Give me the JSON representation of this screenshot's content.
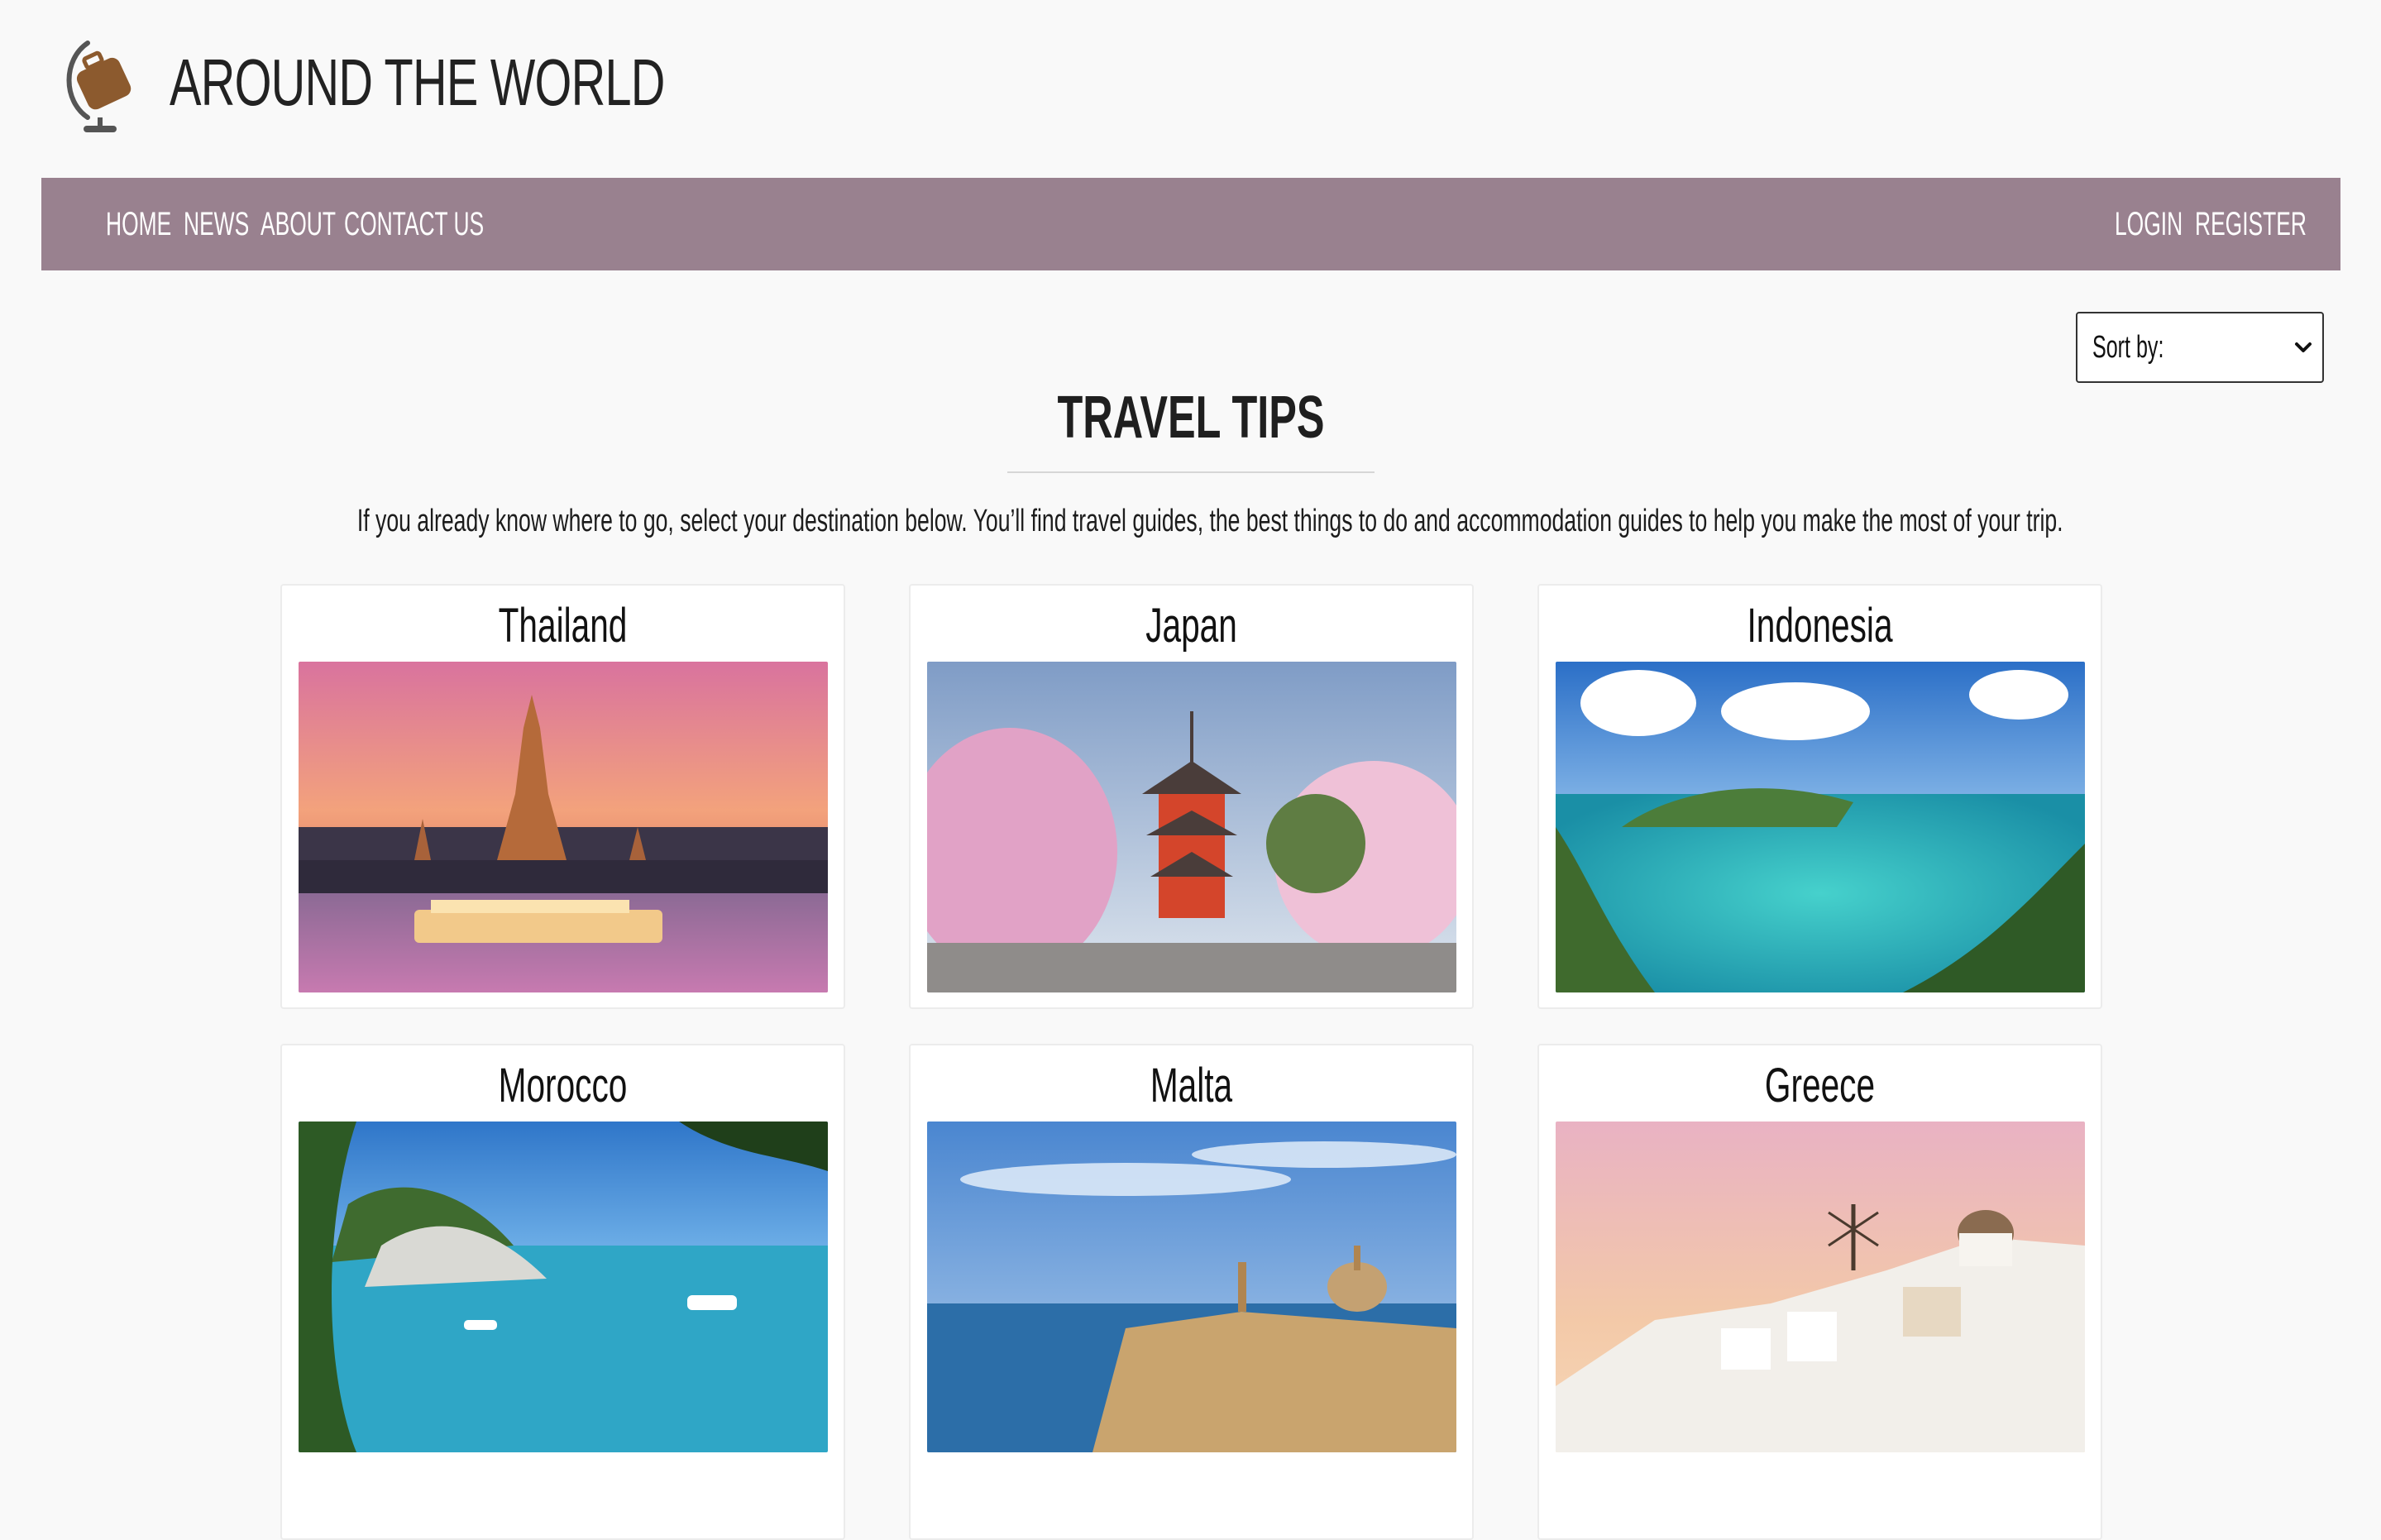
{
  "brand": {
    "name": "AROUND THE WORLD",
    "logo_icon": "globe-suitcase-icon"
  },
  "nav": {
    "left": [
      "HOME",
      "NEWS",
      "ABOUT",
      "CONTACT US"
    ],
    "right": [
      "LOGIN",
      "REGISTER"
    ]
  },
  "sort": {
    "label": "Sort by:",
    "icon": "chevron-down-icon"
  },
  "page": {
    "title": "TRAVEL TIPS",
    "intro": "If you already know where to go, select your destination below. You’ll find travel guides, the best things to do and accommodation guides to help you make the most of your trip."
  },
  "destinations": [
    {
      "name": "Thailand"
    },
    {
      "name": "Japan"
    },
    {
      "name": "Indonesia"
    },
    {
      "name": "Morocco"
    },
    {
      "name": "Malta"
    },
    {
      "name": "Greece"
    }
  ],
  "colors": {
    "navbar": "#99818f",
    "background": "#f9f9f9",
    "card": "#ffffff"
  }
}
